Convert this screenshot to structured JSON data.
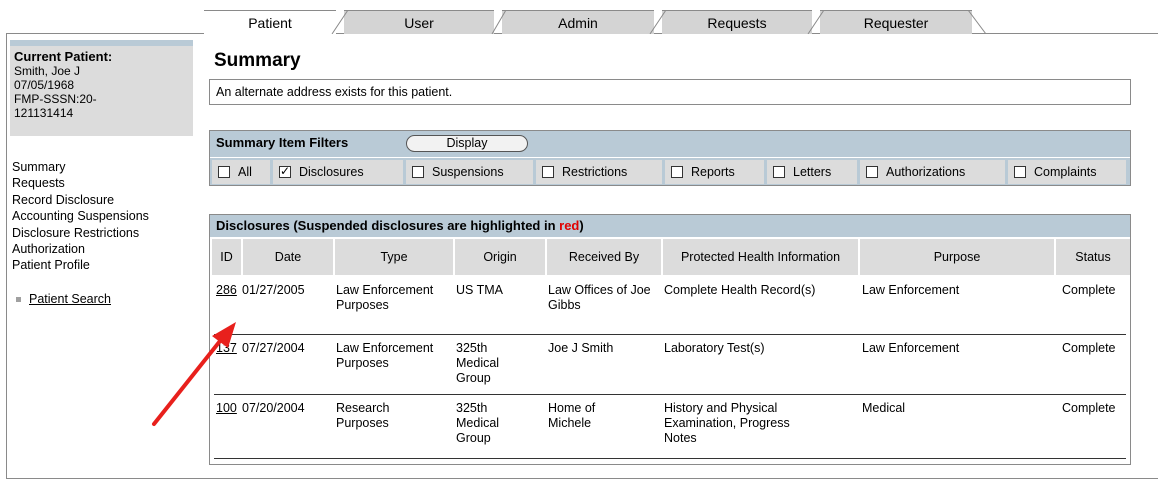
{
  "tabs": [
    "Patient",
    "User",
    "Admin",
    "Requests",
    "Requester"
  ],
  "active_tab": "Patient",
  "current_patient": {
    "label": "Current Patient:",
    "name": "Smith, Joe J",
    "dob": "07/05/1968",
    "id_line1": "FMP-SSSN:20-",
    "id_line2": "121131414"
  },
  "nav": [
    "Summary",
    "Requests",
    "Record Disclosure",
    "Accounting Suspensions",
    "Disclosure Restrictions",
    "Authorization",
    "Patient Profile"
  ],
  "patient_search": "Patient Search",
  "page_title": "Summary",
  "alert": "An alternate address exists for this patient.",
  "filters": {
    "title": "Summary Item Filters",
    "display_button": "Display",
    "items": [
      {
        "label": "All",
        "checked": false
      },
      {
        "label": "Disclosures",
        "checked": true
      },
      {
        "label": "Suspensions",
        "checked": false
      },
      {
        "label": "Restrictions",
        "checked": false
      },
      {
        "label": "Reports",
        "checked": false
      },
      {
        "label": "Letters",
        "checked": false
      },
      {
        "label": "Authorizations",
        "checked": false
      },
      {
        "label": "Complaints",
        "checked": false
      }
    ]
  },
  "disclosures": {
    "caption_prefix": "Disclosures (Suspended disclosures are highlighted in ",
    "caption_red": "red",
    "caption_suffix": ")",
    "highlight_color": "#e00000",
    "columns": [
      "ID",
      "Date",
      "Type",
      "Origin",
      "Received By",
      "Protected Health Information",
      "Purpose",
      "Status"
    ],
    "rows": [
      {
        "id": "286",
        "date": "01/27/2005",
        "type": "Law Enforcement Purposes",
        "origin": "US TMA",
        "received_by": "Law Offices of Joe Gibbs",
        "phi": "Complete Health Record(s)",
        "purpose": "Law Enforcement",
        "status": "Complete"
      },
      {
        "id": "137",
        "date": "07/27/2004",
        "type": "Law Enforcement Purposes",
        "origin": "325th Medical Group",
        "received_by": "Joe J Smith",
        "phi": "Laboratory Test(s)",
        "purpose": "Law Enforcement",
        "status": "Complete"
      },
      {
        "id": "100",
        "date": "07/20/2004",
        "type": "Research Purposes",
        "origin": "325th Medical Group",
        "received_by": "Home of Michele",
        "phi": "History and Physical Examination, Progress Notes",
        "purpose": "Medical",
        "status": "Complete"
      }
    ]
  },
  "annotation_arrow_color": "#e8201c"
}
